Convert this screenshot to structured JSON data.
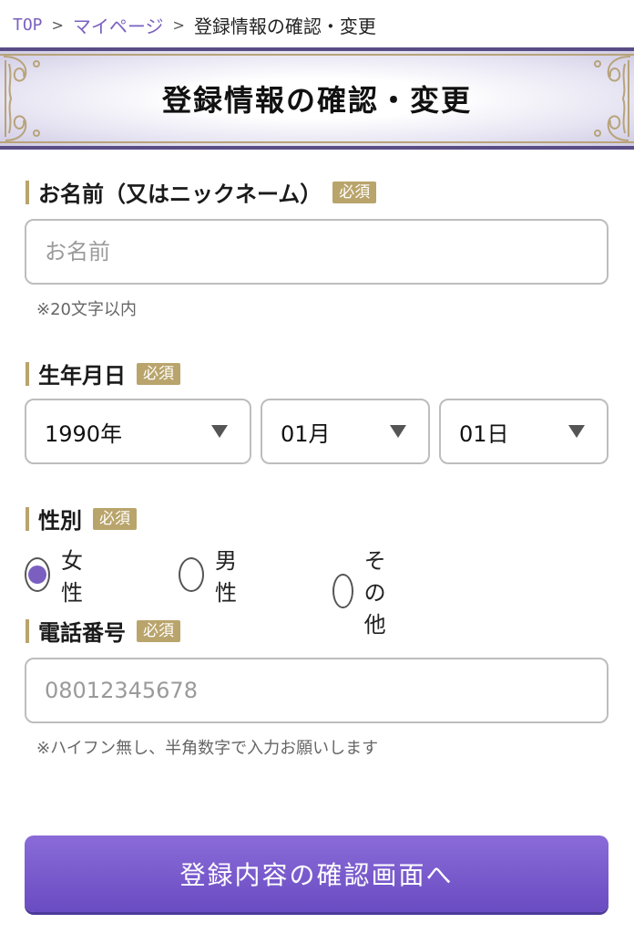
{
  "breadcrumb": {
    "items": [
      "TOP",
      "マイページ",
      "登録情報の確認・変更"
    ],
    "separator": ">"
  },
  "banner": {
    "title": "登録情報の確認・変更"
  },
  "name_field": {
    "label": "お名前（又はニックネーム）",
    "required": "必須",
    "placeholder": "お名前",
    "value": "",
    "hint": "※20文字以内"
  },
  "birthdate_field": {
    "label": "生年月日",
    "required": "必須",
    "year": "1990年",
    "month": "01月",
    "day": "01日"
  },
  "gender_field": {
    "label": "性別",
    "required": "必須",
    "options": [
      "女性",
      "男性",
      "その他"
    ],
    "selected": "女性"
  },
  "phone_field": {
    "label": "電話番号",
    "required": "必須",
    "placeholder": "08012345678",
    "value": "",
    "hint": "※ハイフン無し、半角数字で入力お願いします"
  },
  "submit": {
    "label": "登録内容の確認画面へ"
  },
  "colors": {
    "accent_purple": "#7a5fc0",
    "gold": "#b9a46c",
    "button": "#7457c9"
  },
  "icons": {
    "select_arrow": "triangle-down-icon",
    "banner_ornament": "ornament-icon"
  }
}
